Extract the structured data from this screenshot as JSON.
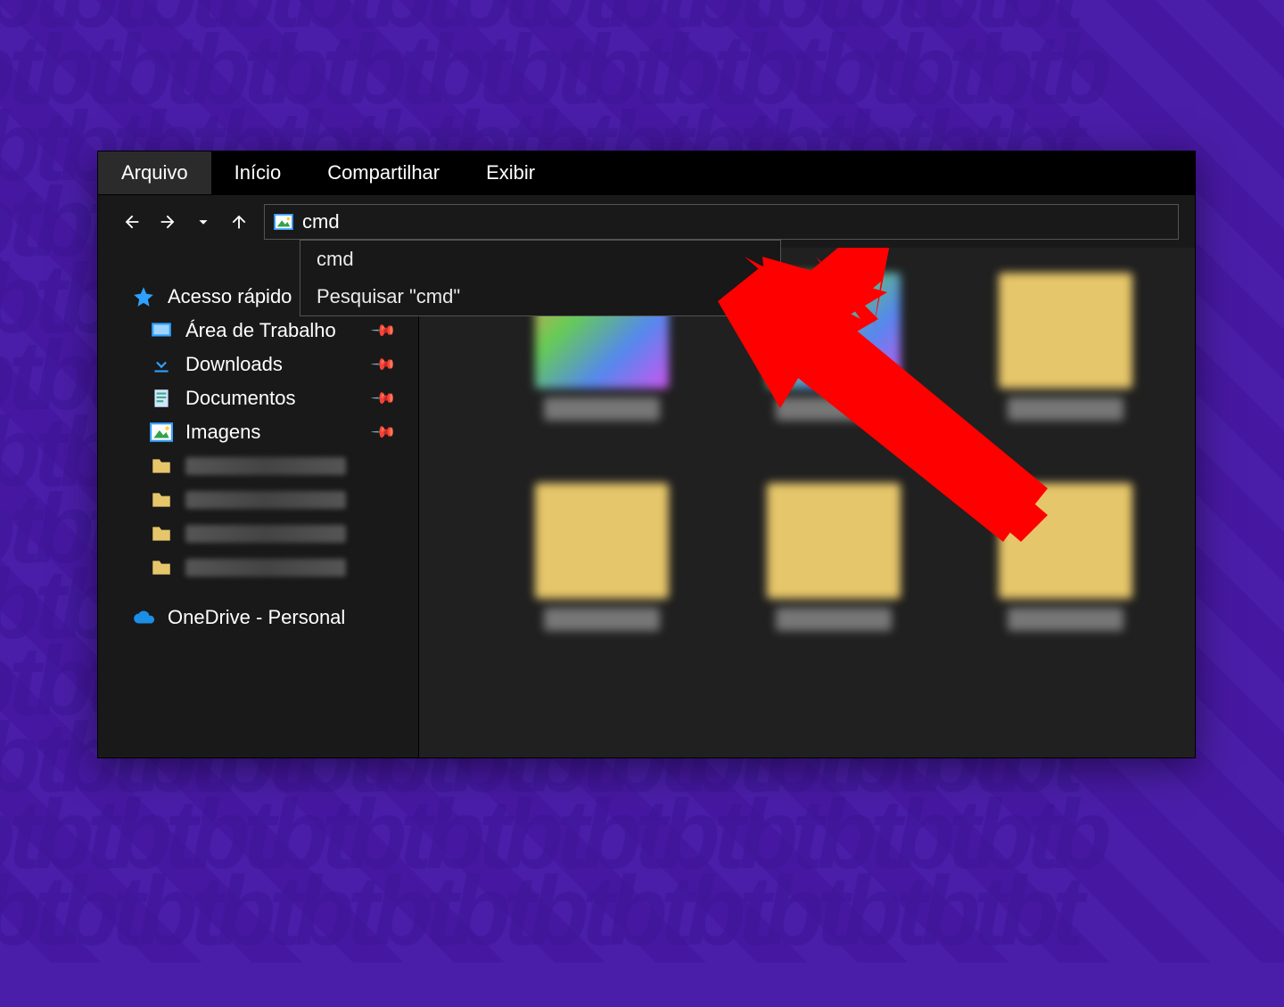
{
  "ribbon": {
    "file": "Arquivo",
    "home": "Início",
    "share": "Compartilhar",
    "view": "Exibir"
  },
  "address": {
    "value": "cmd",
    "suggestions": [
      "cmd",
      "Pesquisar \"cmd\""
    ]
  },
  "sidebar": {
    "quick_access": "Acesso rápido",
    "items": [
      {
        "label": "Área de Trabalho",
        "icon": "desktop"
      },
      {
        "label": "Downloads",
        "icon": "download"
      },
      {
        "label": "Documentos",
        "icon": "document"
      },
      {
        "label": "Imagens",
        "icon": "pictures"
      }
    ],
    "blurred_folder_count": 4,
    "onedrive": "OneDrive - Personal"
  },
  "content": {
    "thumb_count": 6
  },
  "colors": {
    "background": "#4a1ea8",
    "window": "#191919",
    "accent_blue": "#2ea0ff",
    "arrow": "#ff0000"
  }
}
